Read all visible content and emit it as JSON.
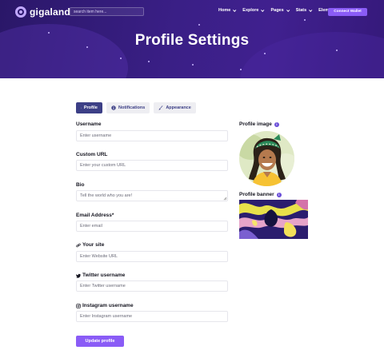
{
  "header": {
    "brand": "gigaland",
    "search_placeholder": "search item here...",
    "nav": [
      {
        "label": "Home"
      },
      {
        "label": "Explore"
      },
      {
        "label": "Pages"
      },
      {
        "label": "Stats"
      },
      {
        "label": "Elements"
      }
    ],
    "connect_wallet": "Connect Wallet"
  },
  "hero": {
    "title": "Profile Settings"
  },
  "tabs": [
    {
      "label": "Profile",
      "icon": "user-icon",
      "active": true
    },
    {
      "label": "Notifications",
      "icon": "info-circle-icon",
      "active": false
    },
    {
      "label": "Appearance",
      "icon": "brush-icon",
      "active": false
    }
  ],
  "form": {
    "username": {
      "label": "Username",
      "placeholder": "Enter username"
    },
    "custom_url": {
      "label": "Custom URL",
      "placeholder": "Enter your custom URL"
    },
    "bio": {
      "label": "Bio",
      "placeholder": "Tell the world who you are!"
    },
    "email": {
      "label": "Email Address*",
      "placeholder": "Enter email"
    },
    "site": {
      "label": "Your site",
      "placeholder": "Enter Website URL",
      "icon": "link-icon"
    },
    "twitter": {
      "label": "Twitter username",
      "placeholder": "Enter Twitter username",
      "icon": "twitter-icon"
    },
    "instagram": {
      "label": "Instagram username",
      "placeholder": "Enter Instagram username",
      "icon": "instagram-icon"
    },
    "submit": "Update profile"
  },
  "side": {
    "profile_image_label": "Profile image",
    "profile_banner_label": "Profile banner",
    "info_glyph": "i"
  },
  "colors": {
    "hero_bg": "#3a1f86",
    "accent": "#8a5cf6",
    "tab_active": "#3c3f86"
  }
}
